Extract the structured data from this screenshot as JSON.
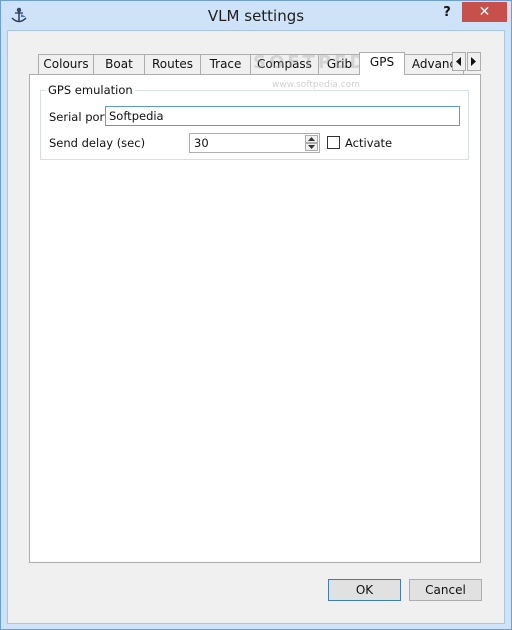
{
  "window": {
    "title": "VLM settings",
    "help_label": "?",
    "close_label": "✕",
    "app_icon": "anchor-icon"
  },
  "tabs": [
    {
      "label": "Colours",
      "active": false
    },
    {
      "label": "Boat",
      "active": false
    },
    {
      "label": "Routes",
      "active": false
    },
    {
      "label": "Trace",
      "active": false
    },
    {
      "label": "Compass",
      "active": false
    },
    {
      "label": "Grib",
      "active": false
    },
    {
      "label": "GPS",
      "active": true
    },
    {
      "label": "Advanc",
      "active": false
    }
  ],
  "tab_scroll": {
    "left_icon": "scroll-left-icon",
    "right_icon": "scroll-right-icon"
  },
  "watermark": {
    "text": "SOFTPEDIA",
    "sub": "www.softpedia.com"
  },
  "gps_group": {
    "title": "GPS emulation",
    "serial_port": {
      "label": "Serial port",
      "value": "Softpedia"
    },
    "send_delay": {
      "label": "Send delay (sec)",
      "value": "30"
    },
    "activate": {
      "label": "Activate",
      "checked": false
    }
  },
  "buttons": {
    "ok": "OK",
    "cancel": "Cancel"
  },
  "colors": {
    "title_bar": "#cfe3f8",
    "close_button": "#c7504a",
    "focus_border": "#5b9ad6"
  }
}
